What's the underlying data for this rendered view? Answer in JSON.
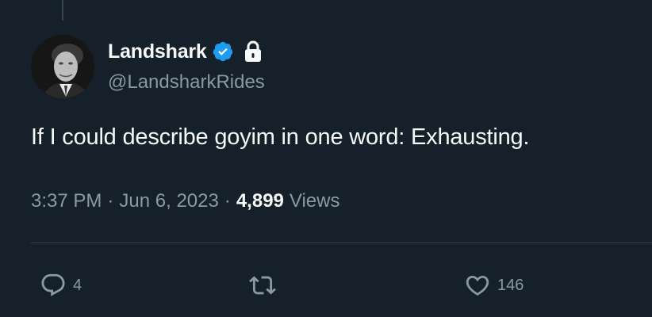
{
  "tweet": {
    "author": {
      "display_name": "Landshark",
      "handle": "@LandsharkRides",
      "verified": true,
      "protected": true
    },
    "text": "If I could describe goyim in one word: Exhausting.",
    "time": "3:37 PM",
    "separator": "·",
    "date": "Jun 6, 2023",
    "views_count": "4,899",
    "views_label": "Views"
  },
  "actions": {
    "reply": {
      "icon": "reply-icon",
      "count": "4"
    },
    "retweet": {
      "icon": "retweet-icon",
      "count": ""
    },
    "like": {
      "icon": "heart-icon",
      "count": "146"
    }
  },
  "colors": {
    "background": "#15202b",
    "text": "#f7f9f9",
    "secondary_text": "#8b98a5",
    "verified": "#1d9bf0",
    "divider": "#38444d"
  }
}
